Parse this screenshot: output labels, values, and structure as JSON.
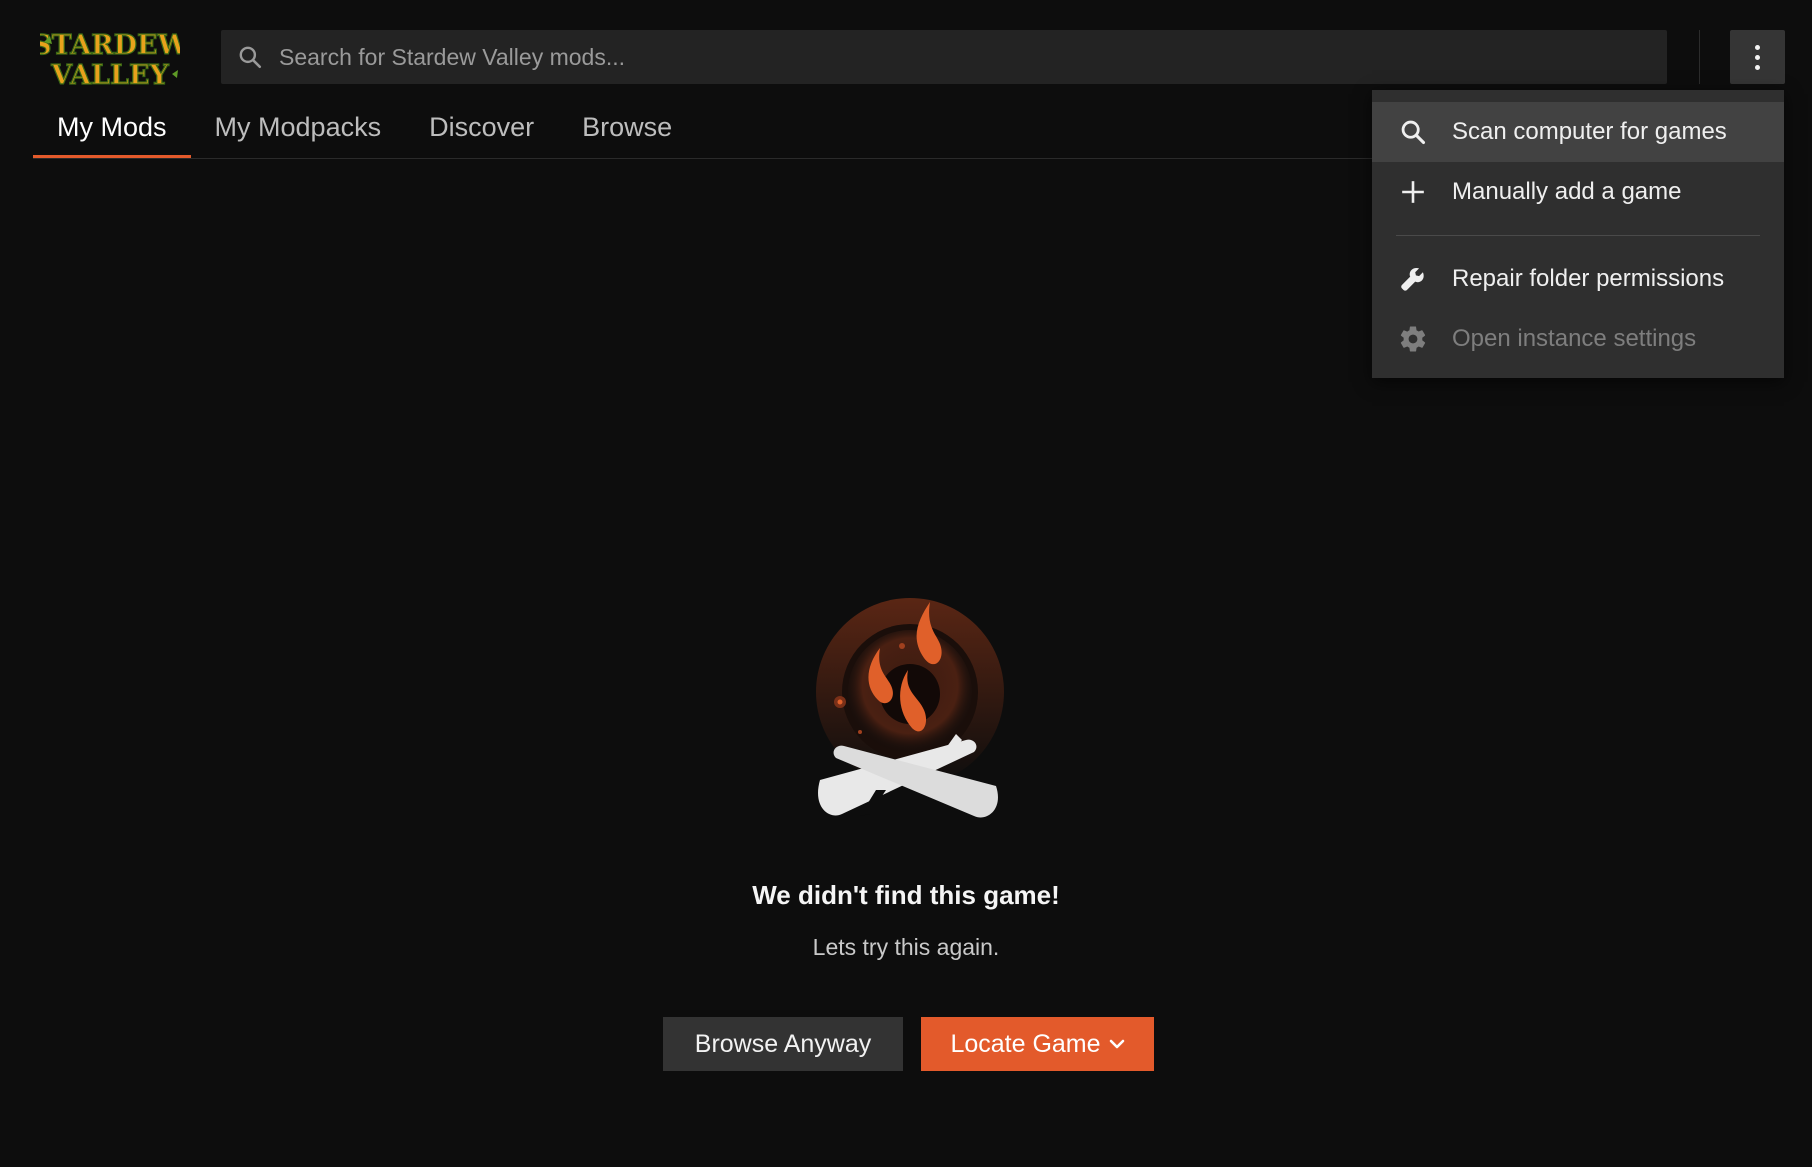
{
  "app": {
    "logo_line1": "STARDEW",
    "logo_line2": "VALLEY",
    "accent_color": "#e35a2b"
  },
  "search": {
    "placeholder": "Search for Stardew Valley mods...",
    "value": "",
    "icon": "search-icon"
  },
  "header": {
    "menu_button_icon": "more-vertical-icon"
  },
  "tabs": [
    {
      "label": "My Mods",
      "active": true
    },
    {
      "label": "My Modpacks",
      "active": false
    },
    {
      "label": "Discover",
      "active": false
    },
    {
      "label": "Browse",
      "active": false
    }
  ],
  "menu": {
    "items": [
      {
        "label": "Scan computer for games",
        "icon": "search-icon",
        "state": "hovered"
      },
      {
        "label": "Manually add a game",
        "icon": "plus-icon",
        "state": "normal"
      },
      {
        "label": "Repair folder permissions",
        "icon": "wrench-icon",
        "state": "normal"
      },
      {
        "label": "Open instance settings",
        "icon": "gear-icon",
        "state": "disabled"
      }
    ]
  },
  "empty_state": {
    "illustration": "campfire-icon",
    "title": "We didn't find this game!",
    "subtitle": "Lets try this again.",
    "browse_button": "Browse Anyway",
    "locate_button": "Locate Game"
  }
}
